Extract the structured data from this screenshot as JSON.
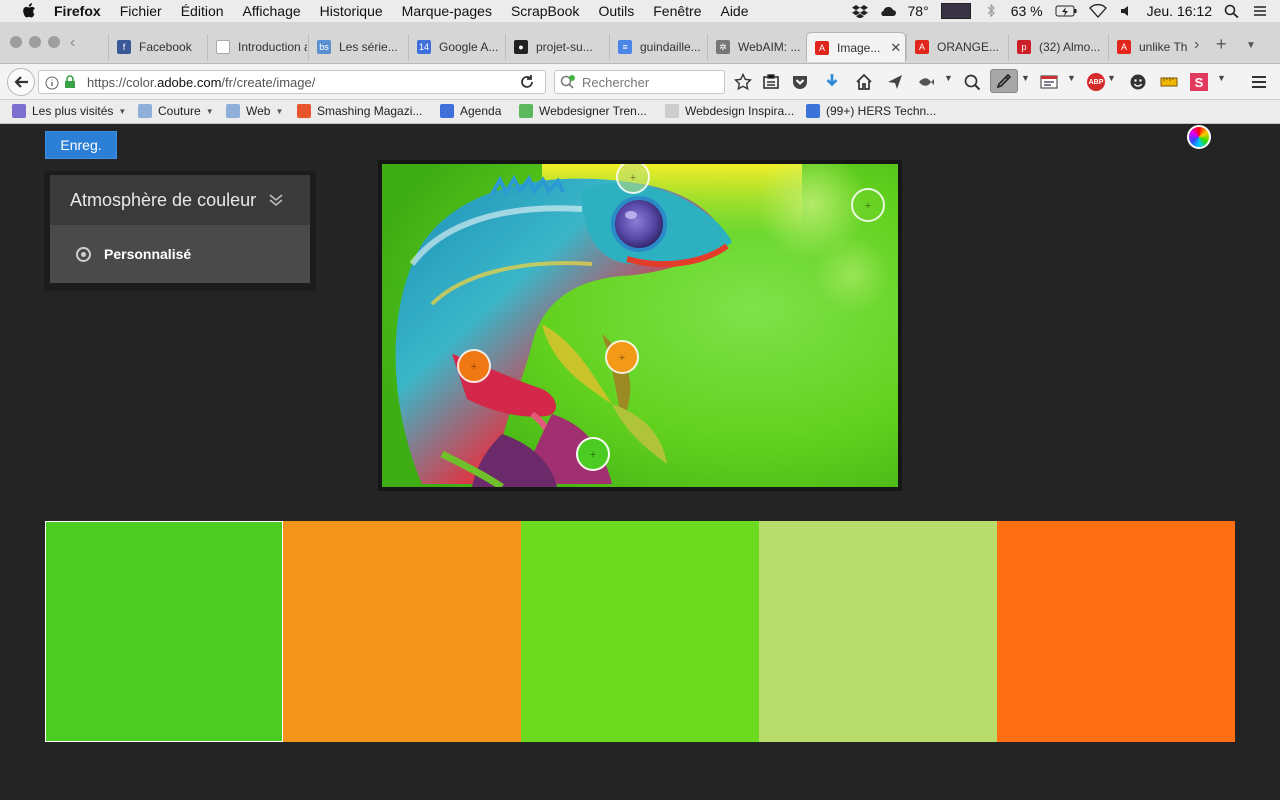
{
  "menubar": {
    "app_name": "Firefox",
    "items": [
      "Fichier",
      "Édition",
      "Affichage",
      "Historique",
      "Marque-pages",
      "ScrapBook",
      "Outils",
      "Fenêtre",
      "Aide"
    ],
    "temperature": "78°",
    "battery": "63 %",
    "clock": "Jeu. 16:12"
  },
  "tabs": [
    {
      "label": "Facebook",
      "icon": "facebook-icon",
      "color": "#3b5998",
      "glyph": "f"
    },
    {
      "label": "Introduction a...",
      "icon": "page-icon",
      "color": "",
      "glyph": ""
    },
    {
      "label": "Les série...",
      "icon": "bs-icon",
      "color": "#5a8fd0",
      "glyph": "bs"
    },
    {
      "label": "Google A...",
      "icon": "calendar-icon",
      "color": "#3f6fd8",
      "glyph": "14"
    },
    {
      "label": "projet-su...",
      "icon": "github-icon",
      "color": "#222222",
      "glyph": "●"
    },
    {
      "label": "guindaille...",
      "icon": "docs-icon",
      "color": "#4a86e8",
      "glyph": "≡"
    },
    {
      "label": "WebAIM: ...",
      "icon": "webaim-icon",
      "color": "#777777",
      "glyph": "✲"
    },
    {
      "label": "Image...",
      "icon": "adobe-icon",
      "color": "#e1251b",
      "glyph": "A",
      "active": true
    },
    {
      "label": "ORANGE...",
      "icon": "adobe-icon",
      "color": "#e1251b",
      "glyph": "A"
    },
    {
      "label": "(32) Almo...",
      "icon": "pinterest-icon",
      "color": "#cb2027",
      "glyph": "p"
    },
    {
      "label": "unlike Th",
      "icon": "adobe-icon",
      "color": "#e1251b",
      "glyph": "A"
    }
  ],
  "navbar": {
    "url_prefix": "https://color.",
    "url_domain": "adobe.com",
    "url_path": "/fr/create/image/",
    "search_placeholder": "Rechercher"
  },
  "bookmarks": [
    {
      "label": "Les plus visités",
      "icon": "most-visited-icon",
      "color": "#7b6fd0",
      "dropdown": true
    },
    {
      "label": "Couture",
      "icon": "folder-icon",
      "color": "#8fb0d8",
      "dropdown": true
    },
    {
      "label": "Web",
      "icon": "folder-icon",
      "color": "#8fb0d8",
      "dropdown": true
    },
    {
      "label": "Smashing Magazi...",
      "icon": "smashing-icon",
      "color": "#e8542b",
      "dropdown": false
    },
    {
      "label": "Agenda",
      "icon": "calendar-icon",
      "color": "#3f6fd8",
      "dropdown": false
    },
    {
      "label": "Webdesigner Tren...",
      "icon": "wdt-icon",
      "color": "#5cb85c",
      "dropdown": false
    },
    {
      "label": "Webdesign Inspira...",
      "icon": "cursor-icon",
      "color": "#cccccc",
      "dropdown": false
    },
    {
      "label": "(99+) HERS Techn...",
      "icon": "chat-icon",
      "color": "#3b73d9",
      "dropdown": false
    }
  ],
  "page": {
    "save_label": "Enreg.",
    "mood_title": "Atmosphère de couleur",
    "mood_option": "Personnalisé"
  },
  "pickers": [
    {
      "name": "picker-1",
      "fill": "rgba(190,220,120,0.55)"
    },
    {
      "name": "picker-2",
      "fill": "rgba(110,210,40,0.55)"
    },
    {
      "name": "picker-3",
      "fill": "#f07812"
    },
    {
      "name": "picker-4",
      "fill": "#f29a18"
    },
    {
      "name": "picker-5",
      "fill": "#4ccb22"
    }
  ],
  "swatches": [
    "#4ccb22",
    "#f39519",
    "#6cda1e",
    "#b8dd6c",
    "#fe6f14"
  ],
  "selected_swatch": 0
}
